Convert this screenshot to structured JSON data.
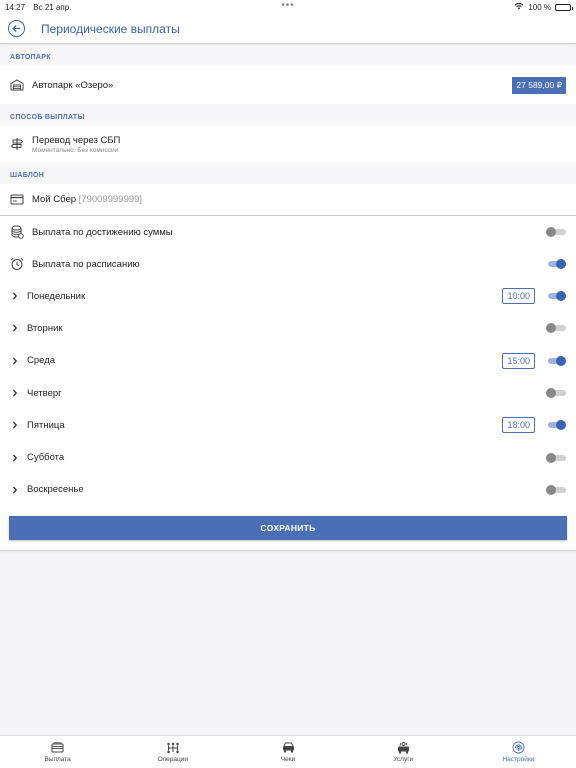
{
  "status_bar": {
    "time": "14:27",
    "date": "Вс 21 апр.",
    "dots": "•••",
    "battery": "100 %"
  },
  "header": {
    "title": "Периодические выплаты"
  },
  "sections": {
    "park": {
      "label": "АВТОПАРК",
      "name": "Автопарк «Озеро»",
      "amount": "27 589,00 ₽"
    },
    "method": {
      "label": "СПОСОБ ВЫПЛАТЫ",
      "name": "Перевод через СБП",
      "sub": "Моментально. Без комиссии"
    },
    "template": {
      "label": "ШАБЛОН",
      "name": "Мой Сбер",
      "number": "[79009999999]"
    }
  },
  "options": {
    "by_amount": {
      "label": "Выплата по достижению суммы",
      "enabled": false
    },
    "by_schedule": {
      "label": "Выплата по расписанию",
      "enabled": true
    }
  },
  "days": [
    {
      "label": "Понедельник",
      "time": "10:00",
      "enabled": true
    },
    {
      "label": "Вторник",
      "time": "",
      "enabled": false
    },
    {
      "label": "Среда",
      "time": "15:00",
      "enabled": true
    },
    {
      "label": "Четверг",
      "time": "",
      "enabled": false
    },
    {
      "label": "Пятница",
      "time": "18:00",
      "enabled": true
    },
    {
      "label": "Суббота",
      "time": "",
      "enabled": false
    },
    {
      "label": "Воскресенье",
      "time": "",
      "enabled": false
    }
  ],
  "save_label": "СОХРАНИТЬ",
  "tabs": [
    {
      "label": "Выплата",
      "icon": "wallet-icon",
      "active": false
    },
    {
      "label": "Операции",
      "icon": "operations-icon",
      "active": false
    },
    {
      "label": "Чеки",
      "icon": "receipts-icon",
      "active": false
    },
    {
      "label": "Услуги",
      "icon": "services-icon",
      "active": false
    },
    {
      "label": "Настройки",
      "icon": "fingerprint-icon",
      "active": true
    }
  ],
  "colors": {
    "accent": "#4a6fb5",
    "toggle_off": "#888888"
  }
}
